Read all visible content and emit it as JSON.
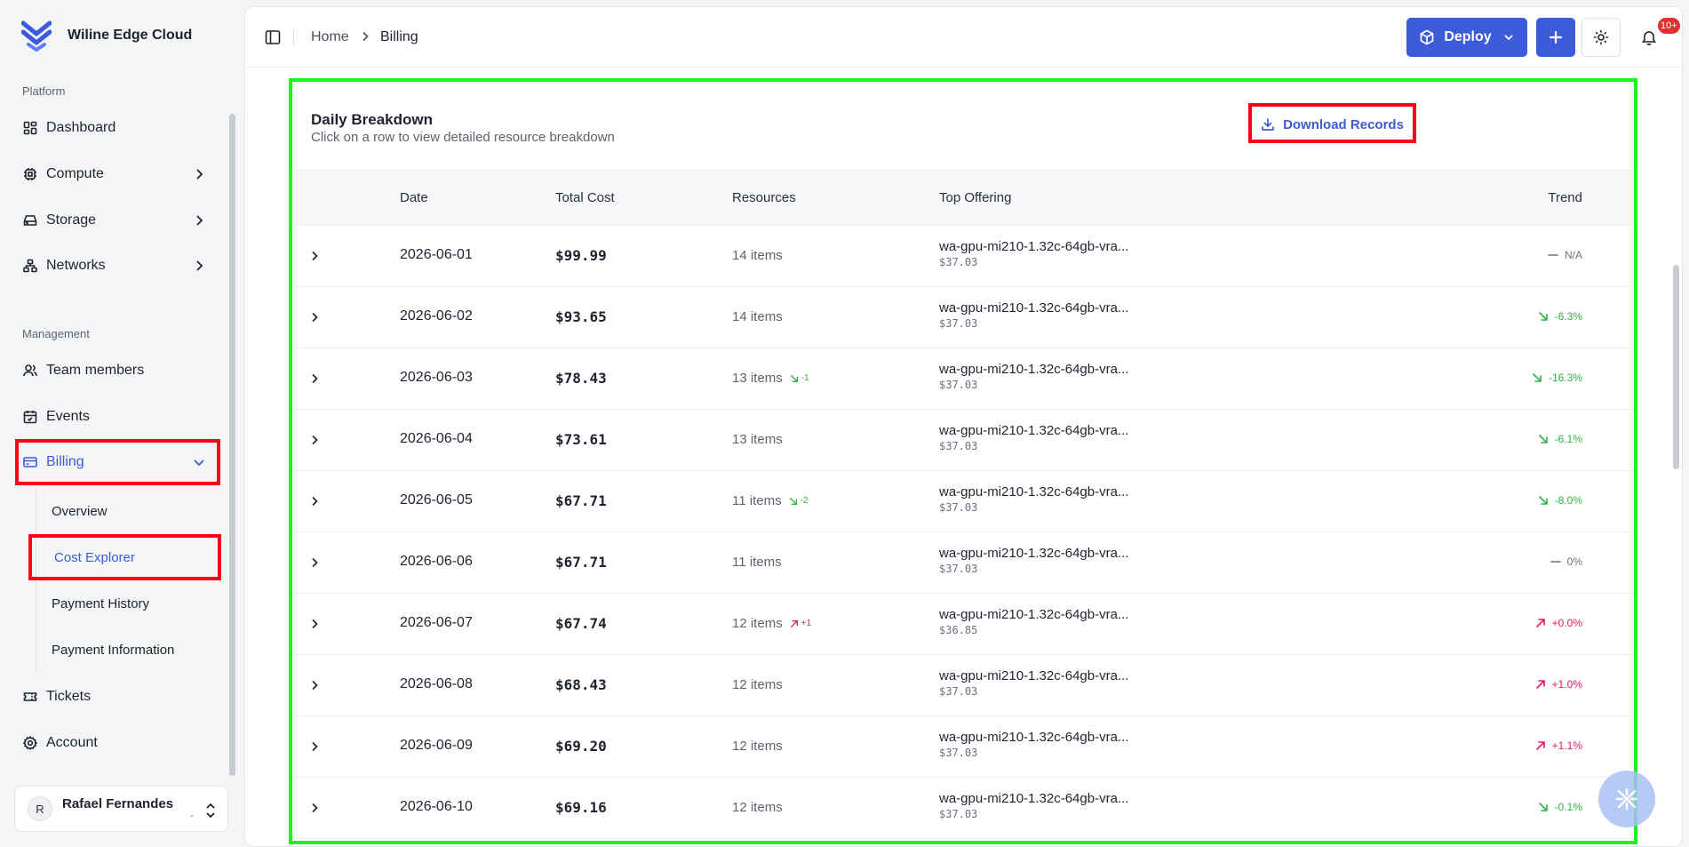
{
  "brand": {
    "name": "Wiline Edge Cloud"
  },
  "sidebar": {
    "section_platform": "Platform",
    "section_management": "Management",
    "items": {
      "dashboard": "Dashboard",
      "compute": "Compute",
      "storage": "Storage",
      "networks": "Networks",
      "team": "Team members",
      "events": "Events",
      "billing": "Billing",
      "tickets": "Tickets",
      "account": "Account"
    },
    "billing_sub": {
      "overview": "Overview",
      "cost_explorer": "Cost Explorer",
      "payment_history": "Payment History",
      "payment_information": "Payment Information"
    },
    "user": {
      "initial": "R",
      "name": "Rafael Fernandes",
      "sub": "-"
    }
  },
  "header": {
    "breadcrumb": {
      "home": "Home",
      "current": "Billing"
    },
    "deploy_label": "Deploy",
    "notifications_badge": "10+"
  },
  "card": {
    "title": "Daily Breakdown",
    "subtitle": "Click on a row to view detailed resource breakdown",
    "download_label": "Download Records",
    "columns": {
      "date": "Date",
      "total_cost": "Total Cost",
      "resources": "Resources",
      "top_offering": "Top Offering",
      "trend": "Trend"
    },
    "rows": [
      {
        "date": "2026-06-01",
        "cost": "$99.99",
        "resources": "14 items",
        "delta": "",
        "delta_dir": "",
        "offering": "wa-gpu-mi210-1.32c-64gb-vra...",
        "offering_cost": "$37.03",
        "trend": "N/A",
        "trend_dir": "flat"
      },
      {
        "date": "2026-06-02",
        "cost": "$93.65",
        "resources": "14 items",
        "delta": "",
        "delta_dir": "",
        "offering": "wa-gpu-mi210-1.32c-64gb-vra...",
        "offering_cost": "$37.03",
        "trend": "-6.3%",
        "trend_dir": "down"
      },
      {
        "date": "2026-06-03",
        "cost": "$78.43",
        "resources": "13 items",
        "delta": "-1",
        "delta_dir": "down",
        "offering": "wa-gpu-mi210-1.32c-64gb-vra...",
        "offering_cost": "$37.03",
        "trend": "-16.3%",
        "trend_dir": "down"
      },
      {
        "date": "2026-06-04",
        "cost": "$73.61",
        "resources": "13 items",
        "delta": "",
        "delta_dir": "",
        "offering": "wa-gpu-mi210-1.32c-64gb-vra...",
        "offering_cost": "$37.03",
        "trend": "-6.1%",
        "trend_dir": "down"
      },
      {
        "date": "2026-06-05",
        "cost": "$67.71",
        "resources": "11 items",
        "delta": "-2",
        "delta_dir": "down",
        "offering": "wa-gpu-mi210-1.32c-64gb-vra...",
        "offering_cost": "$37.03",
        "trend": "-8.0%",
        "trend_dir": "down"
      },
      {
        "date": "2026-06-06",
        "cost": "$67.71",
        "resources": "11 items",
        "delta": "",
        "delta_dir": "",
        "offering": "wa-gpu-mi210-1.32c-64gb-vra...",
        "offering_cost": "$37.03",
        "trend": "0%",
        "trend_dir": "flat"
      },
      {
        "date": "2026-06-07",
        "cost": "$67.74",
        "resources": "12 items",
        "delta": "+1",
        "delta_dir": "up",
        "offering": "wa-gpu-mi210-1.32c-64gb-vra...",
        "offering_cost": "$36.85",
        "trend": "+0.0%",
        "trend_dir": "up"
      },
      {
        "date": "2026-06-08",
        "cost": "$68.43",
        "resources": "12 items",
        "delta": "",
        "delta_dir": "",
        "offering": "wa-gpu-mi210-1.32c-64gb-vra...",
        "offering_cost": "$37.03",
        "trend": "+1.0%",
        "trend_dir": "up"
      },
      {
        "date": "2026-06-09",
        "cost": "$69.20",
        "resources": "12 items",
        "delta": "",
        "delta_dir": "",
        "offering": "wa-gpu-mi210-1.32c-64gb-vra...",
        "offering_cost": "$37.03",
        "trend": "+1.1%",
        "trend_dir": "up"
      },
      {
        "date": "2026-06-10",
        "cost": "$69.16",
        "resources": "12 items",
        "delta": "",
        "delta_dir": "",
        "offering": "wa-gpu-mi210-1.32c-64gb-vra...",
        "offering_cost": "$37.03",
        "trend": "-0.1%",
        "trend_dir": "down"
      }
    ]
  },
  "colors": {
    "accent": "#3b5bdb",
    "highlight_red": "#ff0018",
    "highlight_green": "#22ee22",
    "trend_down": "#2fb344",
    "trend_up": "#e8175d"
  },
  "icons": [
    "wiline-logo-icon",
    "dashboard-icon",
    "cpu-icon",
    "hard-drive-icon",
    "network-icon",
    "users-icon",
    "calendar-icon",
    "credit-card-icon",
    "ticket-icon",
    "gear-icon",
    "sidebar-toggle-icon",
    "chevron-right-icon",
    "box-icon",
    "plus-icon",
    "sun-icon",
    "bell-icon",
    "download-icon",
    "arrow-down-right-icon",
    "arrow-up-right-icon",
    "minus-icon"
  ]
}
